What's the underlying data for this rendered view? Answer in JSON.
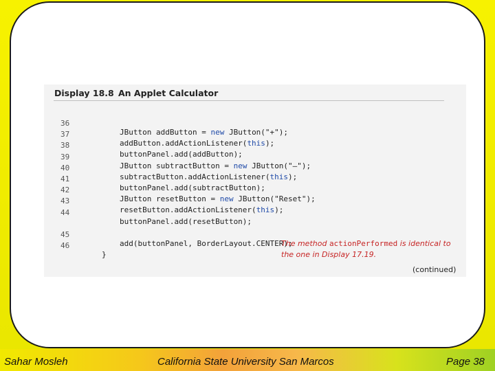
{
  "display": {
    "label": "Display 18.8",
    "title": "An Applet Calculator",
    "lines": [
      {
        "num": "36",
        "text": "JButton addButton = new JButton(\"+\");"
      },
      {
        "num": "37",
        "text": "addButton.addActionListener(this);"
      },
      {
        "num": "38",
        "text": "buttonPanel.add(addButton);"
      },
      {
        "num": "39",
        "text": "JButton subtractButton = new JButton(\"—\");"
      },
      {
        "num": "40",
        "text": "subtractButton.addActionListener(this);"
      },
      {
        "num": "41",
        "text": "buttonPanel.add(subtractButton);"
      },
      {
        "num": "42",
        "text": "JButton resetButton = new JButton(\"Reset\");"
      },
      {
        "num": "43",
        "text": "resetButton.addActionListener(this);"
      },
      {
        "num": "44",
        "text": "buttonPanel.add(resetButton);"
      },
      {
        "num": "45",
        "text": "add(buttonPanel, BorderLayout.CENTER);"
      },
      {
        "num": "46",
        "text": "}"
      }
    ],
    "note_part1": "The method ",
    "note_code": "actionPerformed",
    "note_part2": " is identical to the one in Display 17.19.",
    "continued": "(continued)"
  },
  "footer": {
    "author": "Sahar Mosleh",
    "institution": "California State University San Marcos",
    "page": "Page  38"
  },
  "colors": {
    "background": "#f2ee00",
    "keyword": "#1f4aa8",
    "annotation": "#c62424"
  }
}
